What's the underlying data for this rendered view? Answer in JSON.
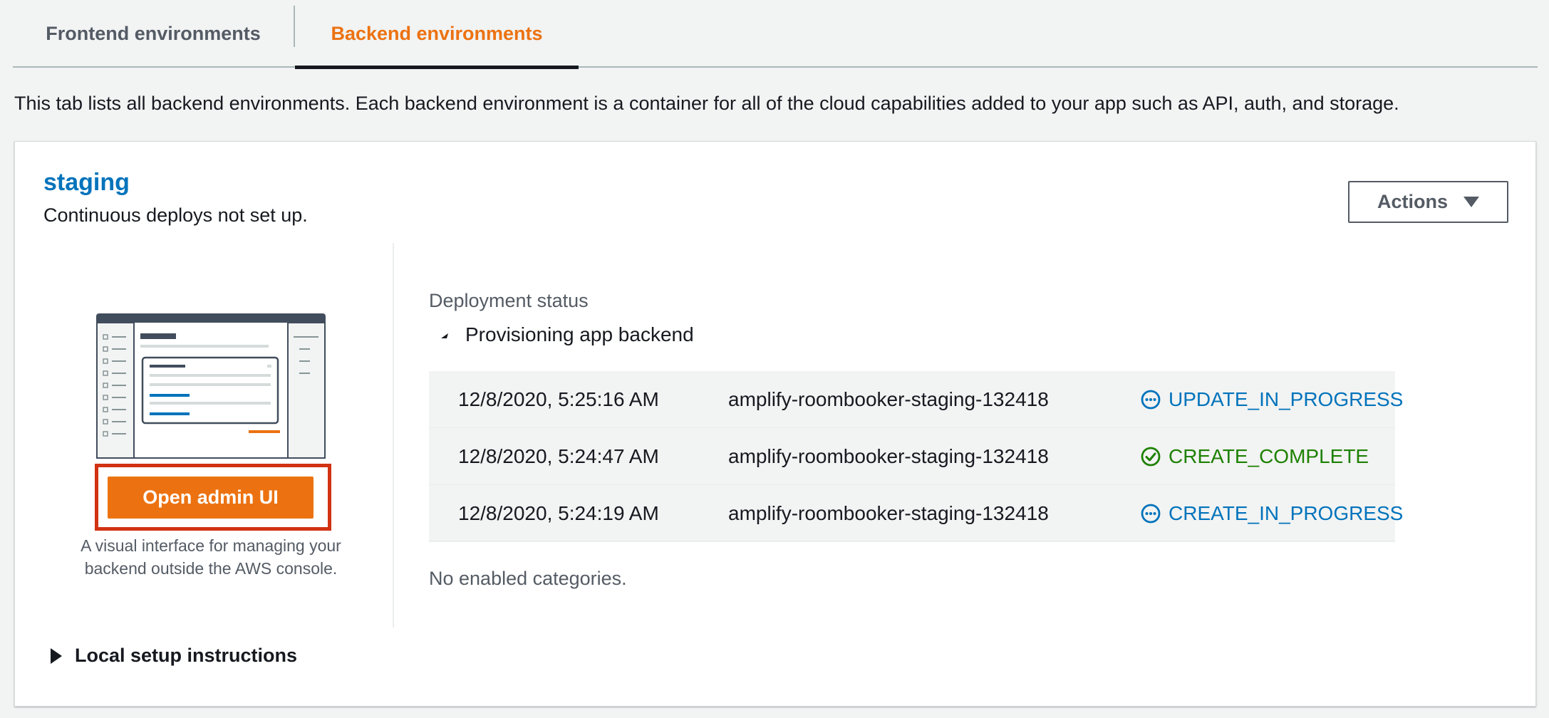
{
  "tabs": {
    "frontend_label": "Frontend environments",
    "backend_label": "Backend environments"
  },
  "description": "This tab lists all backend environments. Each backend environment is a container for all of the cloud capabilities added to your app such as API, auth, and storage.",
  "environment": {
    "name": "staging",
    "subtitle": "Continuous deploys not set up.",
    "actions_label": "Actions"
  },
  "admin": {
    "button_label": "Open admin UI",
    "caption_line1": "A visual interface for managing your",
    "caption_line2": "backend outside the AWS console."
  },
  "deployment": {
    "label": "Deployment status",
    "provisioning_label": "Provisioning app backend",
    "rows": [
      {
        "time": "12/8/2020, 5:25:16 AM",
        "stack": "amplify-roombooker-staging-132418",
        "status": "UPDATE_IN_PROGRESS",
        "icon": "in-progress-icon",
        "color": "#0073bb"
      },
      {
        "time": "12/8/2020, 5:24:47 AM",
        "stack": "amplify-roombooker-staging-132418",
        "status": "CREATE_COMPLETE",
        "icon": "success-check-icon",
        "color": "#1d8102"
      },
      {
        "time": "12/8/2020, 5:24:19 AM",
        "stack": "amplify-roombooker-staging-132418",
        "status": "CREATE_IN_PROGRESS",
        "icon": "in-progress-icon",
        "color": "#0073bb"
      }
    ],
    "no_categories": "No enabled categories."
  },
  "local_setup": {
    "label": "Local setup instructions"
  },
  "colors": {
    "accent_orange": "#ec7211",
    "link_blue": "#0073bb",
    "success_green": "#1d8102",
    "highlight_red": "#d13212"
  }
}
